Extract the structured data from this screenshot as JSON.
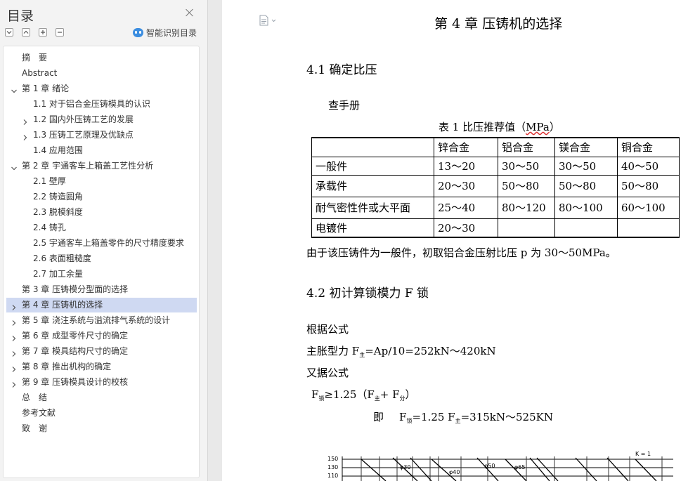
{
  "nav": {
    "title": "目录",
    "smart_toc_label": "智能识别目录",
    "items": [
      {
        "label": "摘　要",
        "level": 0,
        "arrow": "none"
      },
      {
        "label": "Abstract",
        "level": 0,
        "arrow": "none"
      },
      {
        "label": "第 1 章  绪论",
        "level": 0,
        "arrow": "expanded"
      },
      {
        "label": "1.1  对于铝合金压铸模具的认识",
        "level": 1,
        "arrow": "none"
      },
      {
        "label": "1.2  国内外压铸工艺的发展",
        "level": 1,
        "arrow": "collapsed"
      },
      {
        "label": "1.3  压铸工艺原理及优缺点",
        "level": 1,
        "arrow": "collapsed"
      },
      {
        "label": "1.4  应用范围",
        "level": 1,
        "arrow": "none"
      },
      {
        "label": "第 2 章  宇通客车上箱盖工艺性分析",
        "level": 0,
        "arrow": "expanded"
      },
      {
        "label": "2.1 壁厚",
        "level": 1,
        "arrow": "none"
      },
      {
        "label": "2.2 铸造圆角",
        "level": 1,
        "arrow": "none"
      },
      {
        "label": "2.3 脱模斜度",
        "level": 1,
        "arrow": "none"
      },
      {
        "label": "2.4 铸孔",
        "level": 1,
        "arrow": "none"
      },
      {
        "label": "2.5 宇通客车上箱盖零件的尺寸精度要求",
        "level": 1,
        "arrow": "none"
      },
      {
        "label": "2.6 表面粗糙度",
        "level": 1,
        "arrow": "none"
      },
      {
        "label": "2.7 加工余量",
        "level": 1,
        "arrow": "none"
      },
      {
        "label": "第 3 章  压铸模分型面的选择",
        "level": 0,
        "arrow": "none"
      },
      {
        "label": "第 4 章  压铸机的选择",
        "level": 0,
        "arrow": "collapsed",
        "selected": true
      },
      {
        "label": "第 5 章  浇注系统与溢流排气系统的设计",
        "level": 0,
        "arrow": "collapsed"
      },
      {
        "label": "第 6 章  成型零件尺寸的确定",
        "level": 0,
        "arrow": "collapsed"
      },
      {
        "label": "第 7 章  模具结构尺寸的确定",
        "level": 0,
        "arrow": "collapsed"
      },
      {
        "label": "第 8 章  推出机构的确定",
        "level": 0,
        "arrow": "collapsed"
      },
      {
        "label": "第 9 章  压铸模具设计的校核",
        "level": 0,
        "arrow": "collapsed"
      },
      {
        "label": "总　结",
        "level": 0,
        "arrow": "none"
      },
      {
        "label": "参考文献",
        "level": 0,
        "arrow": "none"
      },
      {
        "label": "致　谢",
        "level": 0,
        "arrow": "none"
      }
    ]
  },
  "doc": {
    "chapter_title": "第 4 章  压铸机的选择",
    "section1": "4.1 确定比压",
    "lookup": "查手册",
    "table_caption_pre": "表 1 比压推荐值（",
    "table_caption_unit": "MPa",
    "table_caption_post": "）",
    "table": {
      "headers": [
        "",
        "锌合金",
        "铝合金",
        "镁合金",
        "铜合金"
      ],
      "rows": [
        [
          "一般件",
          "13～20",
          "30～50",
          "30～50",
          "40～50"
        ],
        [
          "承载件",
          "20～30",
          "50～80",
          "50～80",
          "50～80"
        ],
        [
          "耐气密性件或大平面",
          "25～40",
          "80～120",
          "80～100",
          "60～100"
        ],
        [
          "电镀件",
          "20～30",
          "",
          "",
          ""
        ]
      ]
    },
    "para1": "由于该压铸件为一般件，初取铝合金压射比压 p 为 30～50MPa。",
    "section2": "4.2 初计算锁模力 F 锁",
    "formula_intro": "根据公式",
    "f1_pre": "主胀型力  F",
    "f1_sub": "主",
    "f1_post": "=Ap/10=252kN～420kN",
    "formula_intro2": "又据公式",
    "f2_a": "F",
    "f2_sub_a": "锁",
    "f2_b": "≥1.25（F",
    "f2_sub_b": "主",
    "f2_c": "+ F",
    "f2_sub_c": "分",
    "f2_d": "）",
    "f3_ji": "即",
    "f3_a": "F",
    "f3_sub_a": "锁",
    "f3_b": "=1.25 F",
    "f3_sub_b": "主",
    "f3_c": "=315kN～525KN",
    "chart_labels": {
      "y1": "150",
      "y2": "130",
      "y3": "110",
      "k": "K = 1",
      "d30": "φ30",
      "d40": "φ40",
      "d50": "φ50",
      "d65": "φ65"
    }
  }
}
